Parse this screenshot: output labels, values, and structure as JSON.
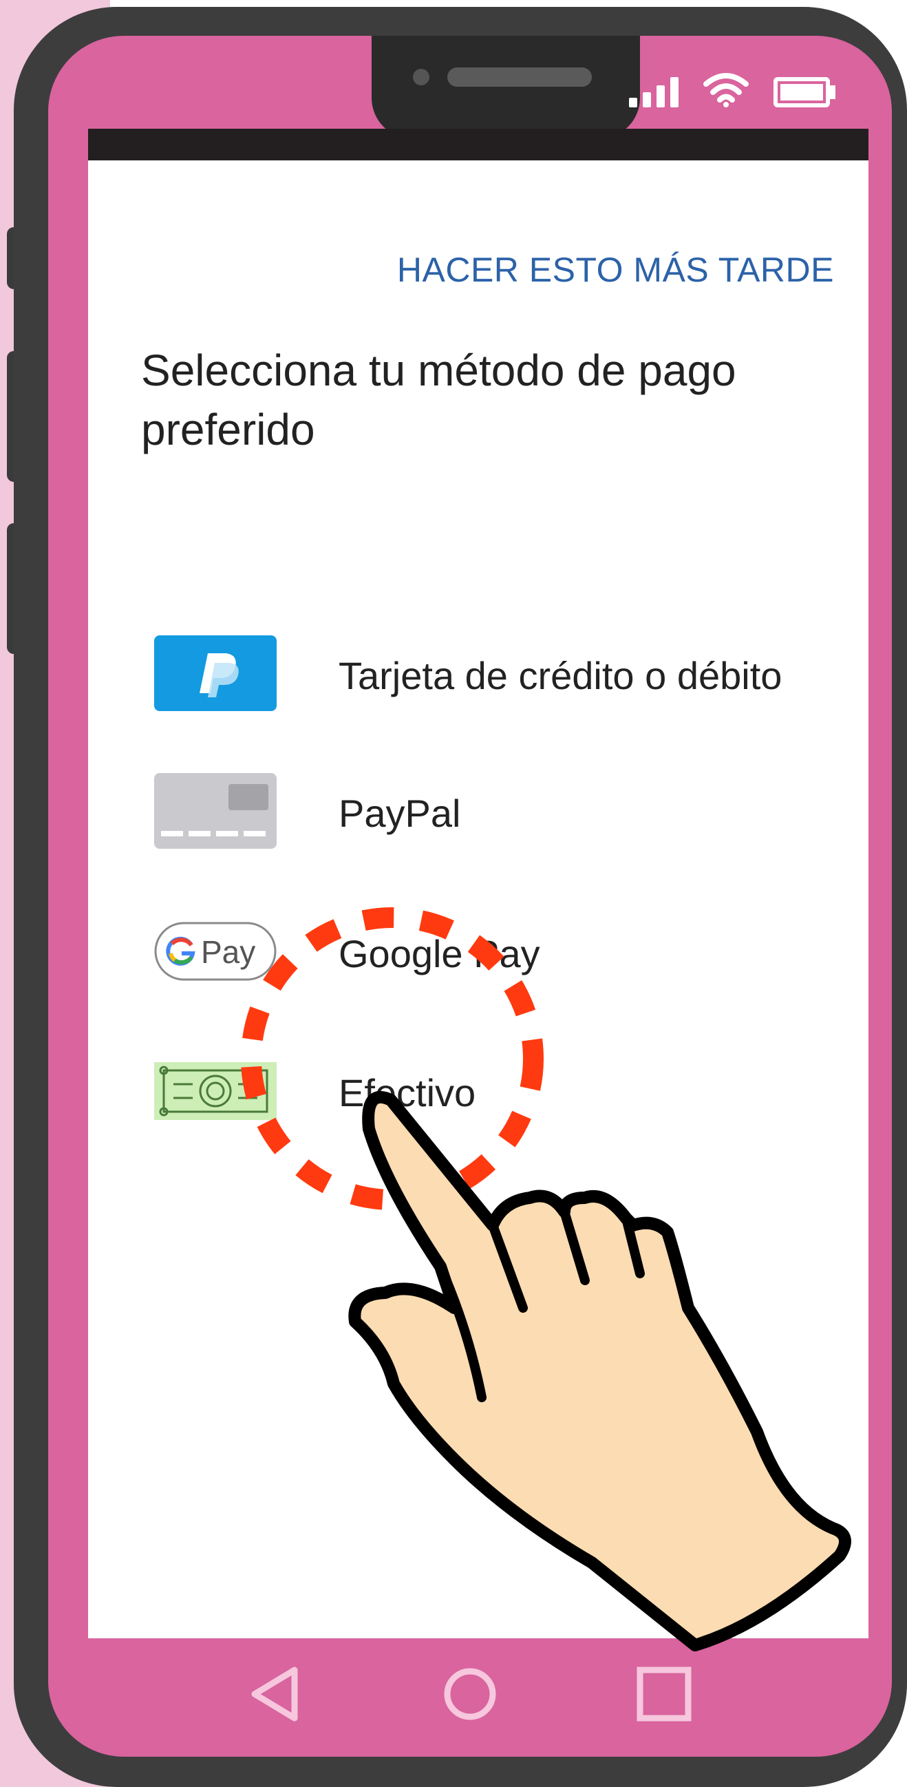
{
  "header": {
    "later_link": "HACER ESTO MÁS TARDE",
    "title": "Selecciona tu método de pago preferido"
  },
  "payment_methods": [
    {
      "label": "Tarjeta de crédito o débito",
      "icon": "paypal-logo-icon"
    },
    {
      "label": "PayPal",
      "icon": "credit-card-icon"
    },
    {
      "label": "Google Pay",
      "icon": "google-pay-icon",
      "icon_text": "Pay"
    },
    {
      "label": "Efectivo",
      "icon": "banknote-icon"
    }
  ],
  "colors": {
    "frame_pink": "#d9649e",
    "link_blue": "#2c62a8",
    "highlight_red": "#ff3a10",
    "hand_skin": "#fcdcb2"
  },
  "nav": {
    "items": [
      "back-icon",
      "home-icon",
      "recent-apps-icon"
    ]
  }
}
